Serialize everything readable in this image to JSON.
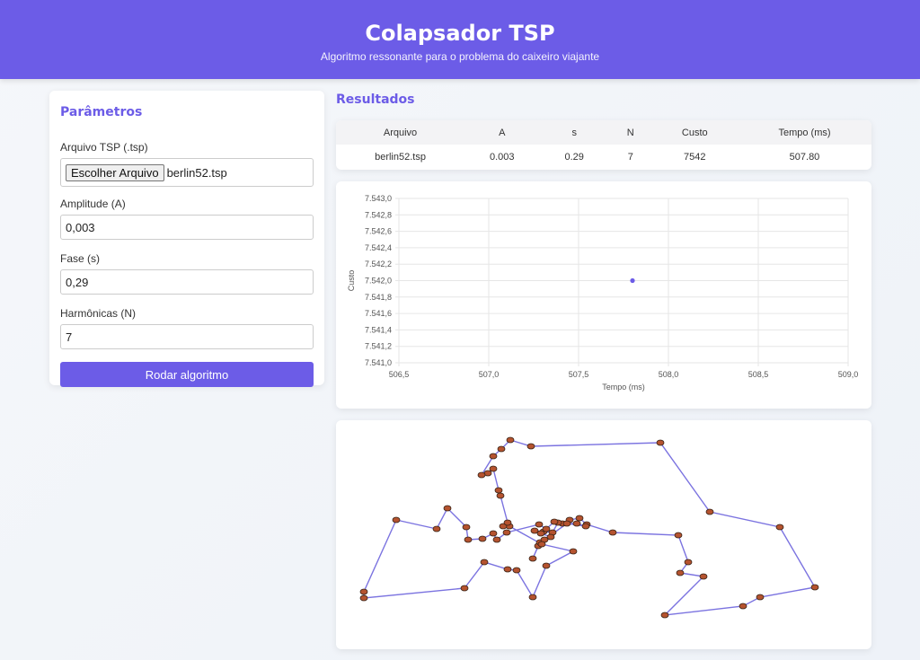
{
  "header": {
    "title": "Colapsador TSP",
    "subtitle": "Algoritmo ressonante para o problema do caixeiro viajante"
  },
  "params": {
    "title": "Parâmetros",
    "file_label": "Arquivo TSP (.tsp)",
    "file_button": "Escolher Arquivo",
    "file_name": "berlin52.tsp",
    "amplitude_label": "Amplitude (A)",
    "amplitude_value": "0,003",
    "phase_label": "Fase (s)",
    "phase_value": "0,29",
    "harmonics_label": "Harmônicas (N)",
    "harmonics_value": "7",
    "run_button": "Rodar algoritmo"
  },
  "results": {
    "title": "Resultados",
    "columns": [
      "Arquivo",
      "A",
      "s",
      "N",
      "Custo",
      "Tempo (ms)"
    ],
    "rows": [
      [
        "berlin52.tsp",
        "0.003",
        "0.29",
        "7",
        "7542",
        "507.80"
      ]
    ]
  },
  "colors": {
    "accent": "#6c5ce7",
    "point": "#6c5ce7",
    "route_line": "#7b73e0",
    "city_fill": "#b5532f"
  },
  "chart_data": {
    "type": "scatter",
    "xlabel": "Tempo (ms)",
    "ylabel": "Custo",
    "xlim": [
      506.5,
      509.0
    ],
    "ylim": [
      7541.0,
      7543.0
    ],
    "x_ticks": [
      "506,5",
      "507,0",
      "507,5",
      "508,0",
      "508,5",
      "509,0"
    ],
    "y_ticks": [
      "7.543,0",
      "7.542,8",
      "7.542,6",
      "7.542,4",
      "7.542,2",
      "7.542,0",
      "7.541,8",
      "7.541,6",
      "7.541,4",
      "7.541,2",
      "7.541,0"
    ],
    "points": [
      {
        "x": 507.8,
        "y": 7542
      }
    ],
    "grid": true
  }
}
